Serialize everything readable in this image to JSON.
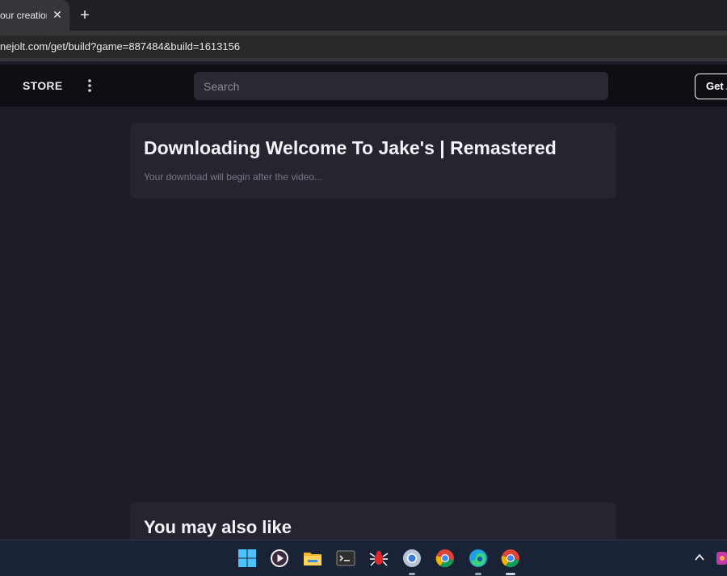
{
  "browser": {
    "tab_title": "our creation",
    "tab_close_glyph": "✕",
    "new_tab_glyph": "+",
    "url": "nejolt.com/get/build?game=887484&build=1613156"
  },
  "header": {
    "store_label": "STORE",
    "more_icon": "more-vertical-icon",
    "search_placeholder": "Search",
    "get_button_label": "Get A"
  },
  "download": {
    "title": "Downloading Welcome To Jake's | Remastered",
    "subtitle": "Your download will begin after the video..."
  },
  "recommendations": {
    "title": "You may also like"
  },
  "taskbar": {
    "icons": [
      "windows-start-icon",
      "media-player-icon",
      "file-explorer-icon",
      "terminal-icon",
      "spider-app-icon",
      "chrome-canary-icon",
      "chrome-icon",
      "edge-icon",
      "chrome-active-icon"
    ],
    "tray": [
      "show-hidden-icons-icon",
      "tray-app-icon"
    ]
  },
  "colors": {
    "page_background": "#1f1c27",
    "header_background": "#0f0e14",
    "card_background": "#27242f",
    "taskbar_background": "#1a2236"
  }
}
